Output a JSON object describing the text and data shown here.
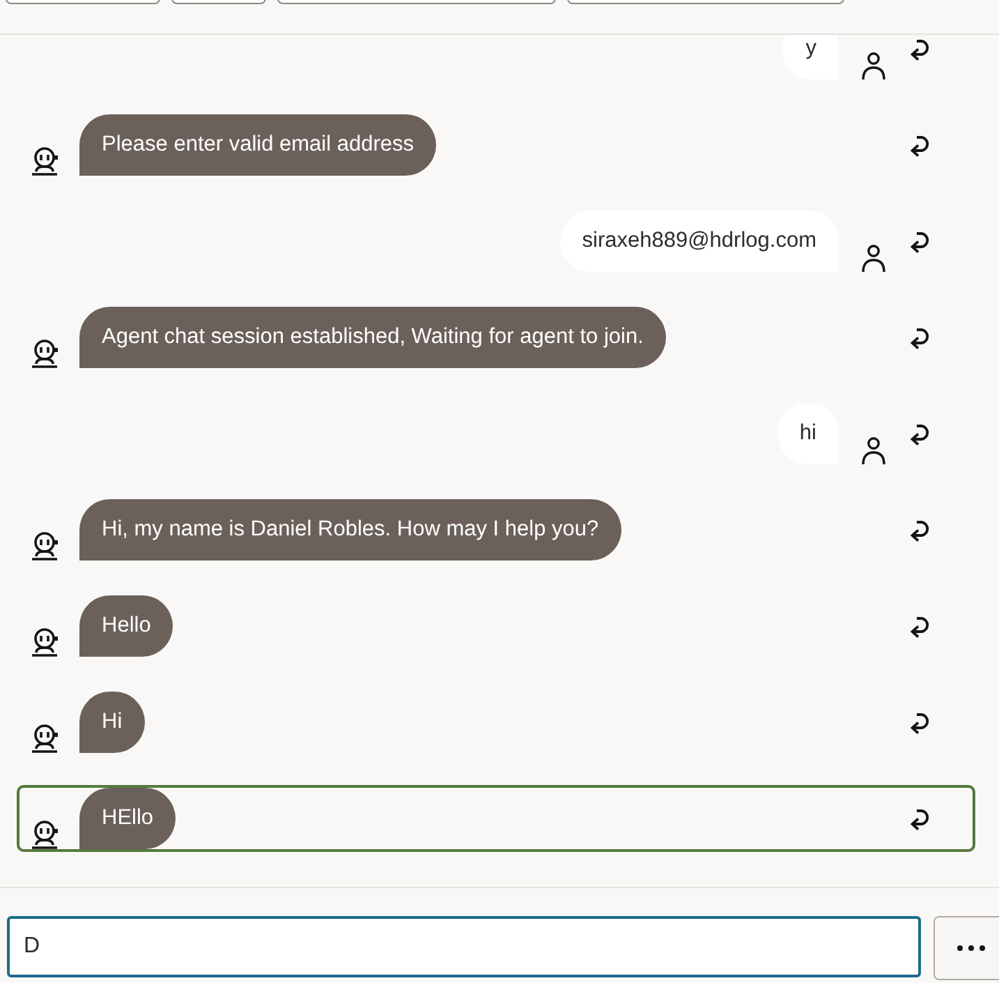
{
  "messages": [
    {
      "kind": "user",
      "text": "y",
      "selected": false
    },
    {
      "kind": "bot",
      "text": "Please enter valid email address",
      "selected": false
    },
    {
      "kind": "user",
      "text": "siraxeh889@hdrlog.com",
      "selected": false
    },
    {
      "kind": "bot",
      "text": "Agent chat session established, Waiting for agent to join.",
      "selected": false
    },
    {
      "kind": "user",
      "text": "hi",
      "selected": false
    },
    {
      "kind": "bot",
      "text": "Hi, my name is Daniel Robles. How may I help you?",
      "selected": false
    },
    {
      "kind": "bot",
      "text": "Hello",
      "selected": false
    },
    {
      "kind": "bot",
      "text": "Hi",
      "selected": false
    },
    {
      "kind": "bot",
      "text": "HEllo",
      "selected": true
    }
  ],
  "composer": {
    "value": "D"
  }
}
